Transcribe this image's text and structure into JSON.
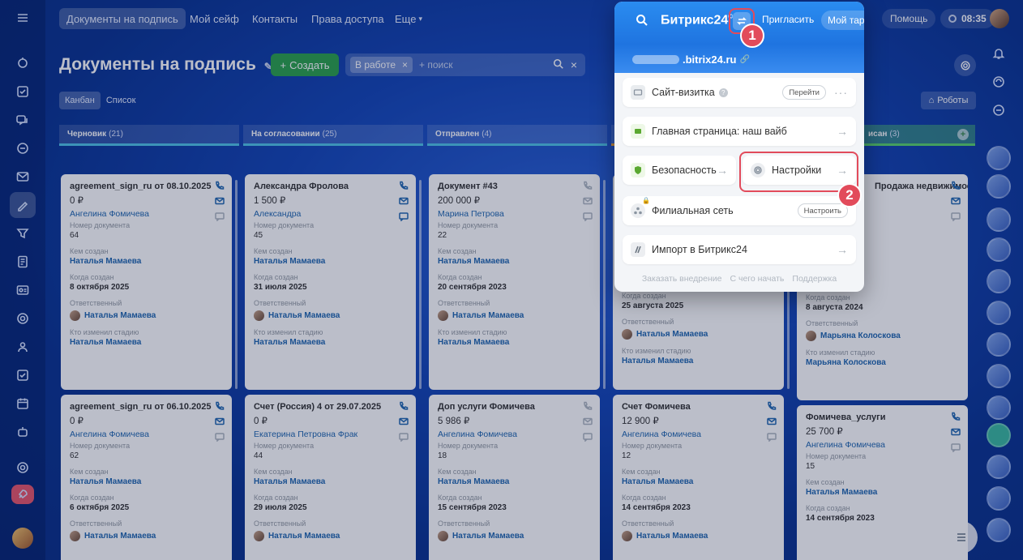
{
  "topbar": {
    "tabs": [
      "Документы на подпись",
      "Мой сейф",
      "Контакты",
      "Права доступа",
      "Еще"
    ],
    "invite": "Пригласить",
    "plan": "Мой тариф",
    "help": "Помощь",
    "time": "08:35"
  },
  "page": {
    "title": "Документы на подпись",
    "create_label": "Создать",
    "filter_tag": "В работе",
    "filter_placeholder": "+ поиск",
    "views": [
      "Канбан",
      "Список"
    ],
    "robots": "Роботы"
  },
  "columns": [
    {
      "name": "Черновик",
      "count": "(21)"
    },
    {
      "name": "На согласовании",
      "count": "(25)"
    },
    {
      "name": "Отправлен",
      "count": "(4)"
    },
    {
      "name": "",
      "count": ""
    },
    {
      "name": "исан",
      "count": "(3)"
    }
  ],
  "labels": {
    "doc_number": "Номер документа",
    "created_by": "Кем создан",
    "created_at": "Когда создан",
    "responsible": "Ответственный",
    "stage_changed": "Кто изменил стадию"
  },
  "cards": [
    {
      "title": "agreement_sign_ru от 08.10.2025",
      "price": "0 ₽",
      "client": "Ангелина Фомичева",
      "number": "64",
      "creator": "Наталья Мамаева",
      "date": "8 октября 2025",
      "responsible": "Наталья Мамаева",
      "stage_by": "Наталья Мамаева"
    },
    {
      "title": "Александра Фролова",
      "price": "1 500 ₽",
      "client": "Александра",
      "number": "45",
      "creator": "Наталья Мамаева",
      "date": "31 июля 2025",
      "responsible": "Наталья Мамаева",
      "stage_by": "Наталья Мамаева"
    },
    {
      "title": "Документ #43",
      "price": "200 000 ₽",
      "client": "Марина Петрова",
      "number": "22",
      "creator": "Наталья Мамаева",
      "date": "20 сентября 2023",
      "responsible": "Наталья Мамаева",
      "stage_by": "Наталья Мамаева"
    },
    {
      "title": "",
      "price": "",
      "client": "",
      "number": "",
      "creator": "",
      "date": "25 августа 2025",
      "responsible": "Наталья Мамаева",
      "stage_by": "Наталья Мамаева"
    },
    {
      "title": "Продажа недвижимости",
      "price": "",
      "client": "",
      "number": "",
      "creator": "",
      "date": "8 августа 2024",
      "responsible": "Марьяна Колоскова",
      "stage_by": "Марьяна Колоскова"
    },
    {
      "title": "agreement_sign_ru от 06.10.2025",
      "price": "0 ₽",
      "client": "Ангелина Фомичева",
      "number": "62",
      "creator": "Наталья Мамаева",
      "date": "6 октября 2025",
      "responsible": "Наталья Мамаева"
    },
    {
      "title": "Счет (Россия) 4 от 29.07.2025",
      "price": "0 ₽",
      "client": "Екатерина Петровна Фрак",
      "number": "44",
      "creator": "Наталья Мамаева",
      "date": "29 июля 2025",
      "responsible": "Наталья Мамаева"
    },
    {
      "title": "Доп услуги Фомичева",
      "price": "5 986 ₽",
      "client": "Ангелина Фомичева",
      "number": "18",
      "creator": "Наталья Мамаева",
      "date": "15 сентября 2023",
      "responsible": "Наталья Мамаева"
    },
    {
      "title": "Счет Фомичева",
      "price": "12 900 ₽",
      "client": "Ангелина Фомичева",
      "number": "12",
      "creator": "Наталья Мамаева",
      "date": "14 сентября 2023",
      "responsible": "Наталья Мамаева"
    },
    {
      "title": "Фомичева_услуги",
      "price": "25 700 ₽",
      "client": "Ангелина Фомичева",
      "number": "15",
      "creator": "Наталья Мамаева",
      "date": "14 сентября 2023",
      "responsible": "Наталья Мамаева"
    }
  ],
  "popup": {
    "logo": "Битрикс24",
    "invite": "Пригласить",
    "plan": "Мой тариф",
    "portal_url": ".bitrix24.ru",
    "items": {
      "site": "Сайт-визитка",
      "site_btn": "Перейти",
      "home": "Главная страница: наш вайб",
      "security": "Безопасность",
      "settings": "Настройки",
      "branch": "Филиальная сеть",
      "branch_btn": "Настроить",
      "import": "Импорт в Битрикс24"
    },
    "footer": [
      "Заказать внедрение",
      "С чего начать",
      "Поддержка"
    ]
  },
  "badges": [
    "1",
    "2"
  ],
  "colors": {
    "accent_red": "#e24b5b",
    "create_green": "#2ca24c",
    "link_blue": "#2067b0"
  }
}
